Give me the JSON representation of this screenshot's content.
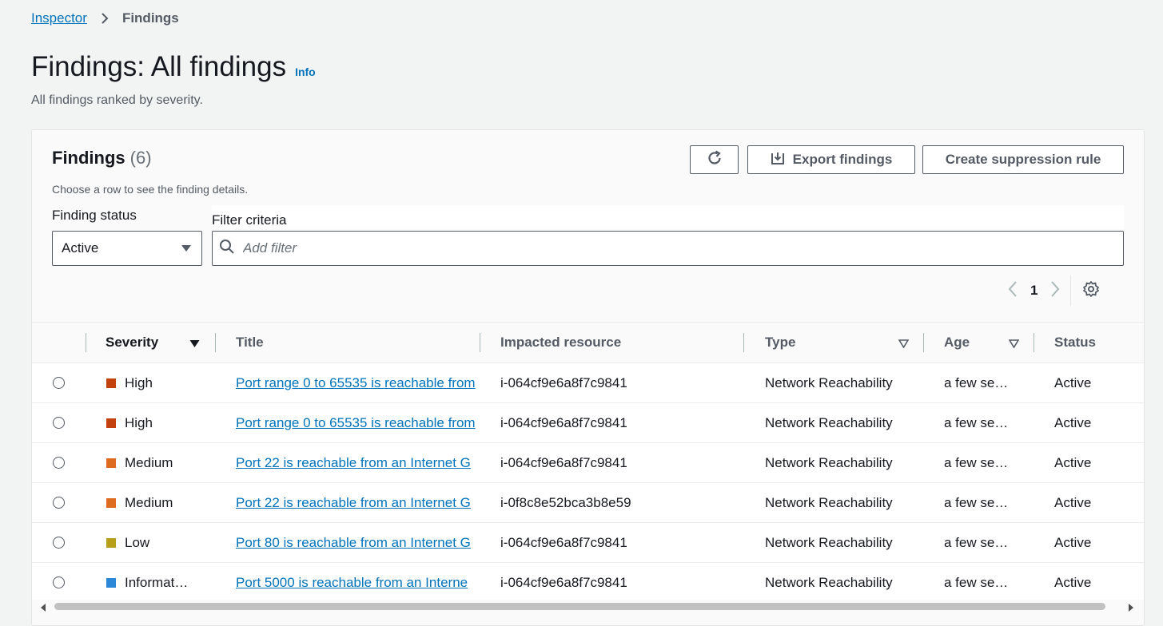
{
  "breadcrumb": {
    "root": "Inspector",
    "current": "Findings"
  },
  "page": {
    "title": "Findings: All findings",
    "info": "Info",
    "description": "All findings ranked by severity."
  },
  "panel": {
    "title": "Findings",
    "count": "(6)",
    "subtitle": "Choose a row to see the finding details.",
    "export_label": "Export findings",
    "suppress_label": "Create suppression rule"
  },
  "filters": {
    "status_label": "Finding status",
    "status_value": "Active",
    "criteria_label": "Filter criteria",
    "search_placeholder": "Add filter"
  },
  "pagination": {
    "page": "1"
  },
  "table": {
    "columns": {
      "severity": "Severity",
      "title": "Title",
      "resource": "Impacted resource",
      "type": "Type",
      "age": "Age",
      "status": "Status"
    },
    "rows": [
      {
        "severity": "High",
        "severity_color": "#c2410c",
        "title": "Port range 0 to 65535 is reachable from",
        "resource": "i-064cf9e6a8f7c9841",
        "type": "Network Reachability",
        "age": "a few se…",
        "status": "Active"
      },
      {
        "severity": "High",
        "severity_color": "#c2410c",
        "title": "Port range 0 to 65535 is reachable from",
        "resource": "i-064cf9e6a8f7c9841",
        "type": "Network Reachability",
        "age": "a few se…",
        "status": "Active"
      },
      {
        "severity": "Medium",
        "severity_color": "#dd6b20",
        "title": "Port 22 is reachable from an Internet G",
        "resource": "i-064cf9e6a8f7c9841",
        "type": "Network Reachability",
        "age": "a few se…",
        "status": "Active"
      },
      {
        "severity": "Medium",
        "severity_color": "#dd6b20",
        "title": "Port 22 is reachable from an Internet G",
        "resource": "i-0f8c8e52bca3b8e59",
        "type": "Network Reachability",
        "age": "a few se…",
        "status": "Active"
      },
      {
        "severity": "Low",
        "severity_color": "#b7a019",
        "title": "Port 80 is reachable from an Internet G",
        "resource": "i-064cf9e6a8f7c9841",
        "type": "Network Reachability",
        "age": "a few se…",
        "status": "Active"
      },
      {
        "severity": "Informat…",
        "severity_color": "#2b87d8",
        "title": "Port 5000 is reachable from an Interne",
        "resource": "i-064cf9e6a8f7c9841",
        "type": "Network Reachability",
        "age": "a few se…",
        "status": "Active"
      }
    ]
  },
  "icons": {
    "chevron": "chevron-right-icon",
    "refresh": "refresh-icon",
    "export": "download-icon",
    "search": "search-icon",
    "settings": "gear-icon"
  }
}
